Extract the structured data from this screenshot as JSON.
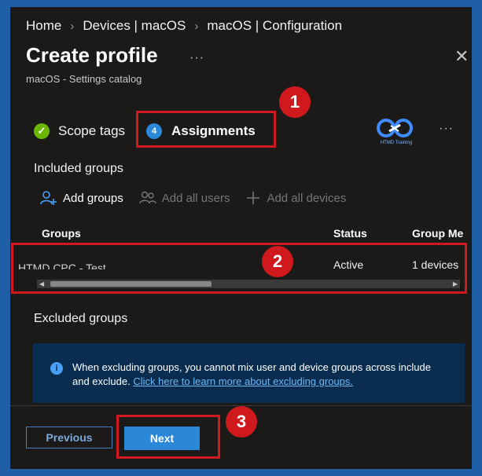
{
  "breadcrumb": [
    "Home",
    "Devices | macOS",
    "macOS | Configuration"
  ],
  "page": {
    "title": "Create profile",
    "subtitle": "macOS - Settings catalog"
  },
  "steps": {
    "scope_tags": "Scope tags",
    "assignments": "Assignments",
    "assignments_number": "4"
  },
  "logo_text": "HTMD Training",
  "included": {
    "label": "Included groups",
    "toolbar": {
      "add_groups": "Add groups",
      "add_all_users": "Add all users",
      "add_all_devices": "Add all devices"
    },
    "columns": [
      "Groups",
      "Status",
      "Group Me"
    ],
    "rows": [
      {
        "group": "HTMD CPC - Test",
        "status": "Active",
        "members": "1 devices"
      }
    ]
  },
  "excluded": {
    "label": "Excluded groups",
    "info_text": "When excluding groups, you cannot mix user and device groups across include and exclude.",
    "info_link": "Click here to learn more about excluding groups."
  },
  "footer": {
    "previous": "Previous",
    "next": "Next"
  },
  "callouts": [
    "1",
    "2",
    "3"
  ],
  "colors": {
    "background": "#1b1a19",
    "outer_frame": "#1f5fa8",
    "accent": "#2b88d8",
    "success": "#6bb700",
    "info_box": "#0a2d4f",
    "annotation_red": "#d0191d"
  }
}
